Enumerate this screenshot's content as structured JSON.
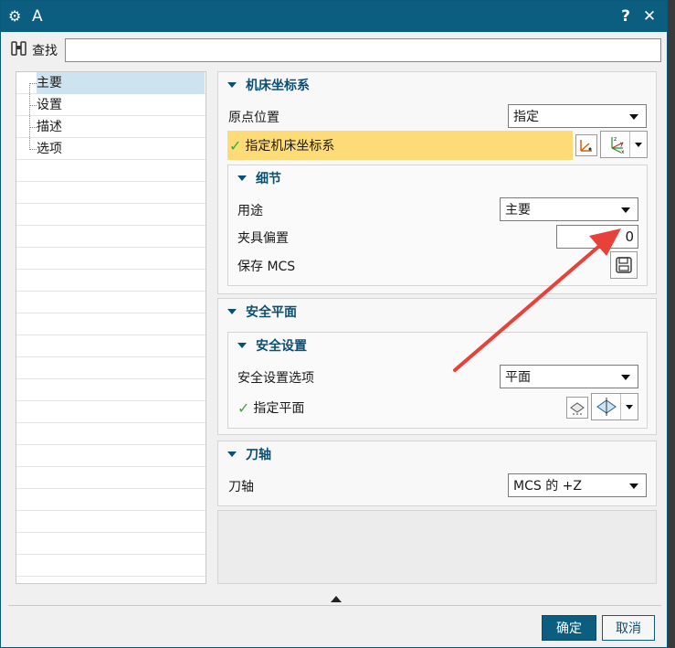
{
  "window": {
    "title": "A",
    "help": "?",
    "close": "✕"
  },
  "search": {
    "label": "查找",
    "value": "",
    "placeholder": ""
  },
  "tree": {
    "items": [
      {
        "label": "主要",
        "selected": true
      },
      {
        "label": "设置",
        "selected": false
      },
      {
        "label": "描述",
        "selected": false
      },
      {
        "label": "选项",
        "selected": false
      }
    ]
  },
  "machine_csys": {
    "title": "机床坐标系",
    "origin_label": "原点位置",
    "origin_value": "指定",
    "specify_label": "指定机床坐标系",
    "details": {
      "title": "细节",
      "purpose_label": "用途",
      "purpose_value": "主要",
      "fixture_label": "夹具偏置",
      "fixture_value": "0",
      "save_label": "保存 MCS"
    }
  },
  "safe_plane": {
    "title": "安全平面",
    "settings": {
      "title": "安全设置",
      "option_label": "安全设置选项",
      "option_value": "平面",
      "specify_label": "指定平面"
    }
  },
  "tool_axis": {
    "title": "刀轴",
    "label": "刀轴",
    "value": "MCS 的 +Z"
  },
  "footer": {
    "ok": "确定",
    "cancel": "取消"
  },
  "colors": {
    "titlebar": "#0b5e80",
    "highlight": "#fddc78",
    "accent": "#0b4f73",
    "annotation": "#e8413a"
  }
}
